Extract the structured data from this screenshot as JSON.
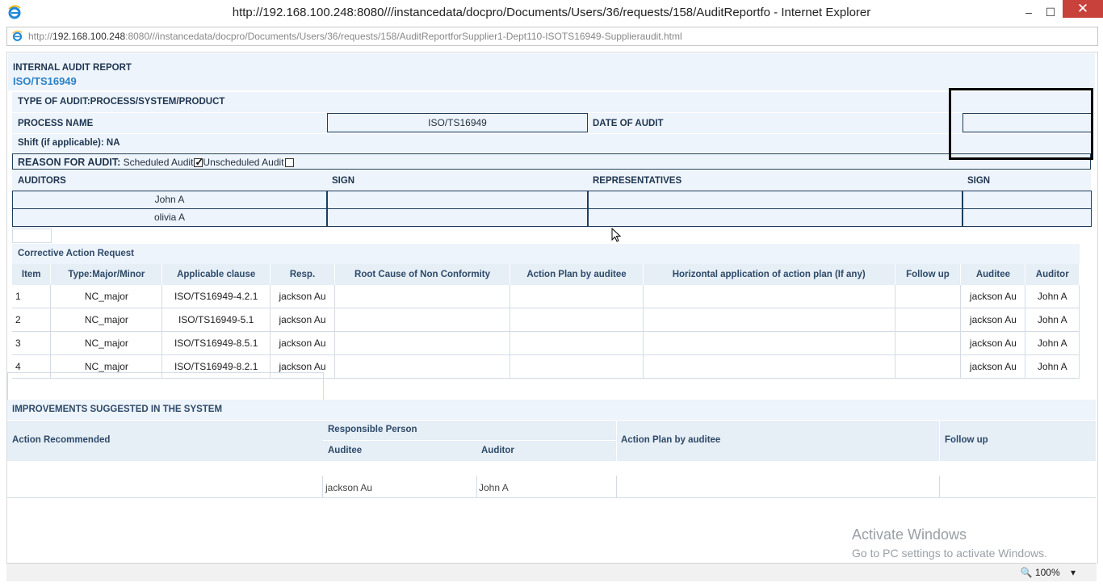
{
  "window": {
    "title": "http://192.168.100.248:8080///instancedata/docpro/Documents/Users/36/requests/158/AuditReportfo - Internet Explorer",
    "minimize": "–",
    "maximize": "☐",
    "close": "✕"
  },
  "address": {
    "prefix": "http://",
    "host": "192.168.100.248",
    "path": ":8080///instancedata/docpro/Documents/Users/36/requests/158/AuditReportforSupplier1-Dept110-ISOTS16949-Supplieraudit.html"
  },
  "report": {
    "title": "INTERNAL AUDIT REPORT",
    "standard": "ISO/TS16949",
    "type_of_audit": "TYPE OF AUDIT:PROCESS/SYSTEM/PRODUCT",
    "process_name_label": "PROCESS NAME",
    "process_name_value": "ISO/TS16949",
    "date_label": "DATE OF AUDIT",
    "date_value": "",
    "shift": "Shift (if applicable): NA",
    "reason_label": "REASON FOR AUDIT:",
    "scheduled": "Scheduled Audit",
    "unscheduled": "Unscheduled Audit"
  },
  "people": {
    "auditors_label": "AUDITORS",
    "sign_label": "SIGN",
    "representatives_label": "REPRESENTATIVES",
    "sign2_label": "SIGN",
    "auditors": [
      "John A",
      "olivia A"
    ]
  },
  "car": {
    "title": "Corrective Action Request",
    "headers": [
      "Item",
      "Type:Major/Minor",
      "Applicable clause",
      "Resp.",
      "Root Cause of Non Conformity",
      "Action Plan by auditee",
      "Horizontal application of action plan (If any)",
      "Follow up",
      "Auditee",
      "Auditor"
    ],
    "rows": [
      [
        "1",
        "NC_major",
        "ISO/TS16949-4.2.1",
        "jackson Au",
        "",
        "",
        "",
        "",
        "jackson Au",
        "John A"
      ],
      [
        "2",
        "NC_major",
        "ISO/TS16949-5.1",
        "jackson Au",
        "",
        "",
        "",
        "",
        "jackson Au",
        "John A"
      ],
      [
        "3",
        "NC_major",
        "ISO/TS16949-8.5.1",
        "jackson Au",
        "",
        "",
        "",
        "",
        "jackson Au",
        "John A"
      ],
      [
        "4",
        "NC_major",
        "ISO/TS16949-8.2.1",
        "jackson Au",
        "",
        "",
        "",
        "",
        "jackson Au",
        "John A"
      ]
    ]
  },
  "improvements": {
    "title": "IMPROVEMENTS SUGGESTED IN THE SYSTEM",
    "action_recommended": "Action Recommended",
    "responsible_person": "Responsible Person",
    "auditee": "Auditee",
    "auditor": "Auditor",
    "action_plan": "Action Plan by auditee",
    "follow_up": "Follow up",
    "row": {
      "auditee": "jackson Au",
      "auditor": "John A"
    }
  },
  "status": {
    "zoom": "100%"
  },
  "watermark": {
    "line1": "Activate Windows",
    "line2": "Go to PC settings to activate Windows."
  }
}
